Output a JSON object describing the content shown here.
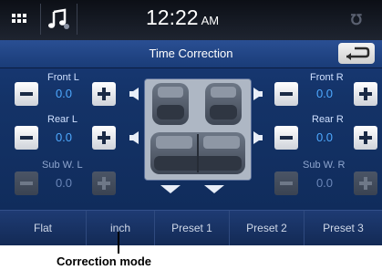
{
  "status": {
    "time": "12:22",
    "ampm": "AM",
    "icons": [
      "grid-icon",
      "music-note-icon",
      "bluetooth-icon"
    ]
  },
  "header": {
    "title": "Time Correction"
  },
  "channels": {
    "front_l": {
      "label": "Front L",
      "value": "0.0"
    },
    "front_r": {
      "label": "Front R",
      "value": "0.0"
    },
    "rear_l": {
      "label": "Rear L",
      "value": "0.0"
    },
    "rear_r": {
      "label": "Rear R",
      "value": "0.0"
    },
    "sub_l": {
      "label": "Sub W. L",
      "value": "0.0"
    },
    "sub_r": {
      "label": "Sub W. R",
      "value": "0.0"
    }
  },
  "tabs": [
    "Flat",
    "inch",
    "Preset 1",
    "Preset 2",
    "Preset 3"
  ],
  "annotation": {
    "label": "Correction mode"
  },
  "colors": {
    "accent": "#4ea9ff",
    "background": "#143368"
  }
}
